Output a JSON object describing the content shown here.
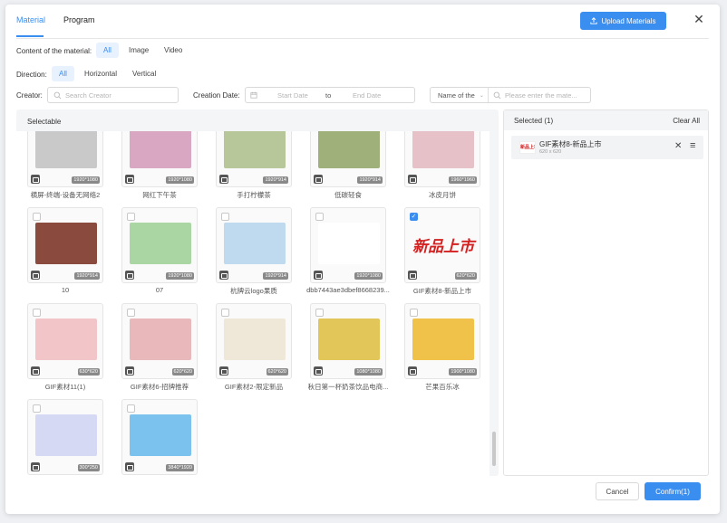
{
  "tabs": [
    "Material",
    "Program"
  ],
  "upload_label": "Upload Materials",
  "content_label": "Content of the material:",
  "content_chips": [
    "All",
    "Image",
    "Video"
  ],
  "direction_label": "Direction:",
  "direction_chips": [
    "All",
    "Horizontal",
    "Vertical"
  ],
  "creator_label": "Creator:",
  "creator_placeholder": "Search Creator",
  "date_label": "Creation Date:",
  "start_date": "Start Date",
  "to": "to",
  "end_date": "End Date",
  "name_select": "Name of the",
  "name_placeholder": "Please enter the mate...",
  "selectable_label": "Selectable",
  "selected_label": "Selected (1)",
  "clear_all": "Clear All",
  "selected_item": {
    "name": "GIF素材8-新品上市",
    "dims": "620 x 620",
    "thumb_text": "新品上市"
  },
  "cancel": "Cancel",
  "confirm": "Confirm(1)",
  "items": [
    {
      "name": "横屏-终端-设备无网络2",
      "dims": "1920*1080",
      "checked": false,
      "color": "#c9c9c9"
    },
    {
      "name": "网红下午茶",
      "dims": "1920*1080",
      "checked": false,
      "color": "#d9a7c2"
    },
    {
      "name": "手打柠檬茶",
      "dims": "1920*914",
      "checked": false,
      "color": "#b7c79a"
    },
    {
      "name": "低碳轻食",
      "dims": "1920*914",
      "checked": false,
      "color": "#9fb07a"
    },
    {
      "name": "冰皮月饼",
      "dims": "1960*1960",
      "checked": false,
      "color": "#e6c2c8"
    },
    {
      "name": "10",
      "dims": "1920*914",
      "checked": false,
      "color": "#8a4a3e"
    },
    {
      "name": "07",
      "dims": "1920*1080",
      "checked": false,
      "color": "#aad6a4"
    },
    {
      "name": "杭牌云logo果质",
      "dims": "1920*914",
      "checked": false,
      "color": "#bfd9ee"
    },
    {
      "name": "dbb7443ae3dbef8668239...",
      "dims": "1920*1080",
      "checked": false,
      "color": "#ffffff"
    },
    {
      "name": "GIF素材8-新品上市",
      "dims": "620*620",
      "checked": true,
      "color": "#ffffff"
    },
    {
      "name": "GIF素材11(1)",
      "dims": "630*620",
      "checked": false,
      "color": "#f2c6c8"
    },
    {
      "name": "GIF素材6-招牌推荐",
      "dims": "620*620",
      "checked": false,
      "color": "#e8b8bb"
    },
    {
      "name": "GIF素材2-限定新品",
      "dims": "620*620",
      "checked": false,
      "color": "#efe8d8"
    },
    {
      "name": "秋日第一杯奶茶饮品电商...",
      "dims": "1080*1080",
      "checked": false,
      "color": "#e2c65a"
    },
    {
      "name": "芒果百乐冰",
      "dims": "1900*1080",
      "checked": false,
      "color": "#f1c24a"
    },
    {
      "name": "",
      "dims": "300*250",
      "checked": false,
      "color": "#d6d9f3"
    },
    {
      "name": "",
      "dims": "3840*1920",
      "checked": false,
      "color": "#7bc3ee"
    }
  ],
  "accent": "#3a8ef0"
}
